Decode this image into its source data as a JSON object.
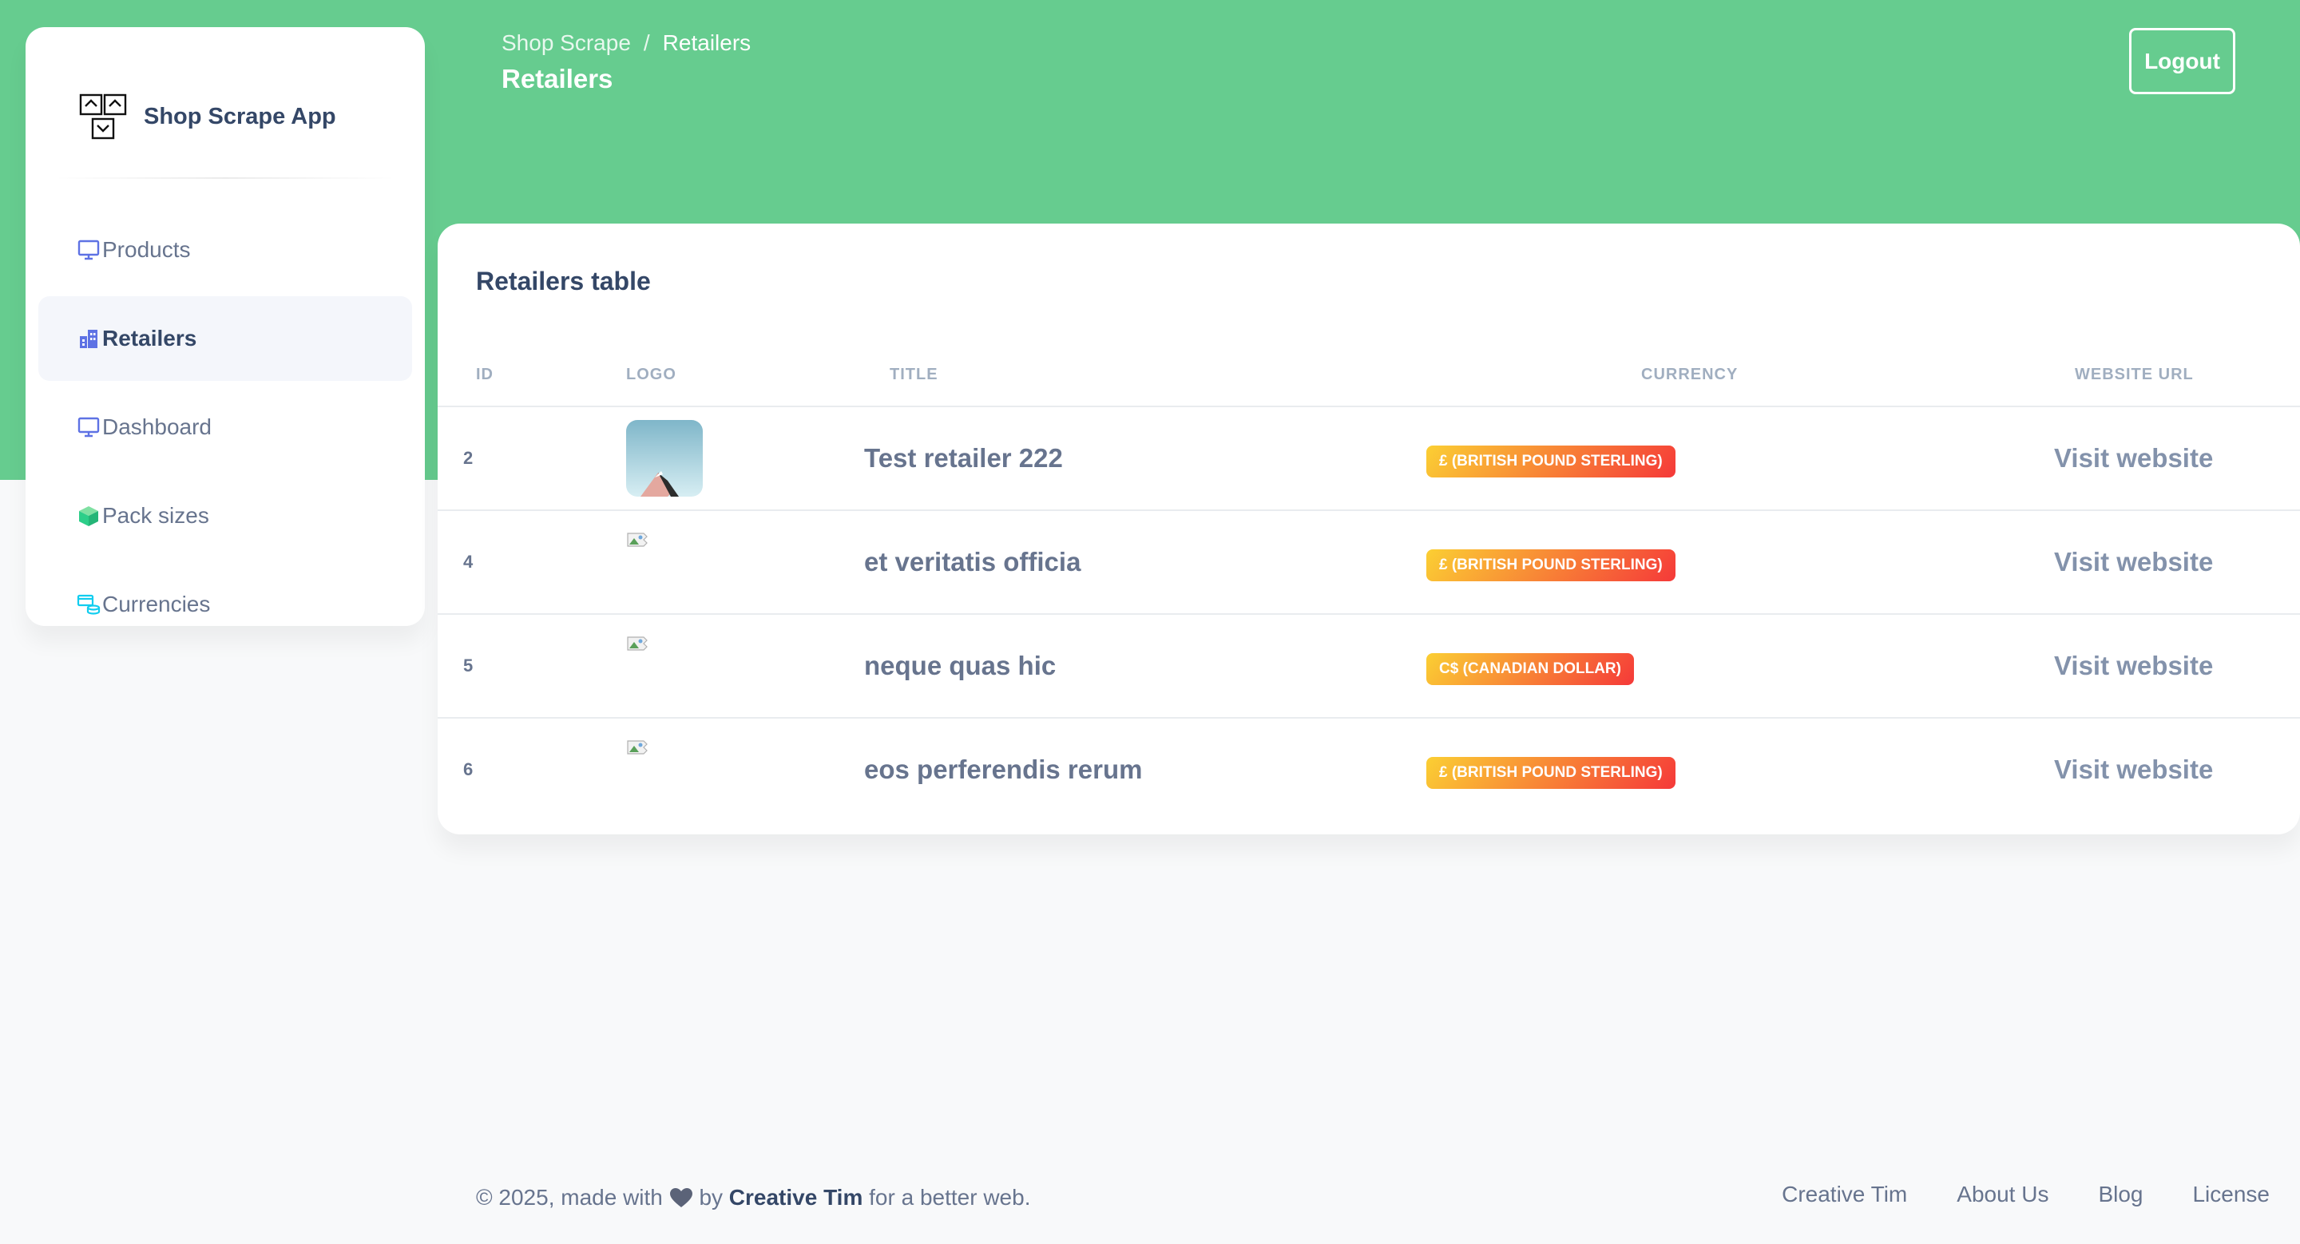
{
  "app": {
    "name": "Shop Scrape App"
  },
  "breadcrumb": {
    "root": "Shop Scrape",
    "separator": "/",
    "current": "Retailers"
  },
  "page_title": "Retailers",
  "logout_label": "Logout",
  "sidebar": {
    "items": [
      {
        "label": "Products",
        "icon": "monitor-icon",
        "active": false
      },
      {
        "label": "Retailers",
        "icon": "office-building-icon",
        "active": true
      },
      {
        "label": "Dashboard",
        "icon": "monitor-icon",
        "active": false
      },
      {
        "label": "Pack sizes",
        "icon": "box-icon",
        "active": false
      },
      {
        "label": "Currencies",
        "icon": "credit-card-icon",
        "active": false
      }
    ]
  },
  "table": {
    "title": "Retailers table",
    "columns": [
      "ID",
      "LOGO",
      "TITLE",
      "CURRENCY",
      "WEBSITE URL"
    ],
    "rows": [
      {
        "id": "2",
        "logo": "photo",
        "title": "Test retailer 222",
        "currency": "£ (BRITISH POUND STERLING)",
        "link": "Visit website"
      },
      {
        "id": "4",
        "logo": "broken-image",
        "title": "et veritatis officia",
        "currency": "£ (BRITISH POUND STERLING)",
        "link": "Visit website"
      },
      {
        "id": "5",
        "logo": "broken-image",
        "title": "neque quas hic",
        "currency": "C$ (CANADIAN DOLLAR)",
        "link": "Visit website"
      },
      {
        "id": "6",
        "logo": "broken-image",
        "title": "eos perferendis rerum",
        "currency": "£ (BRITISH POUND STERLING)",
        "link": "Visit website"
      }
    ]
  },
  "footer": {
    "prefix": "© 2025, made with",
    "by": "by",
    "author": "Creative Tim",
    "suffix": "for a better web.",
    "links": [
      "Creative Tim",
      "About Us",
      "Blog",
      "License"
    ]
  },
  "colors": {
    "header_green": "#66cc8f",
    "badge_gradient_start": "#fbcf33",
    "badge_gradient_end": "#f53939",
    "text_primary": "#344767",
    "text_muted": "#67748e"
  }
}
